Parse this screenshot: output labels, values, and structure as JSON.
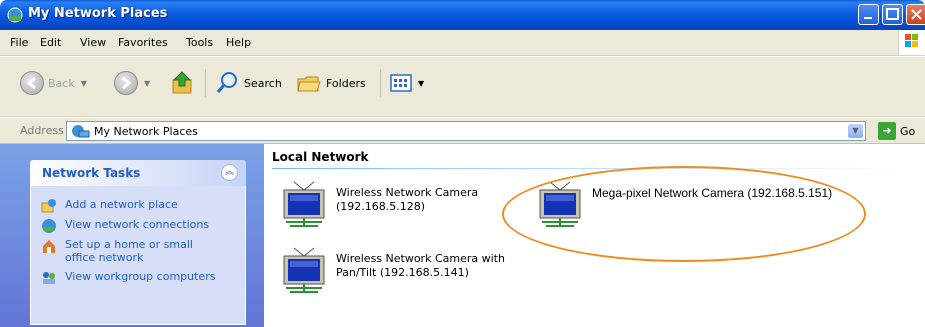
{
  "window": {
    "title": "My Network Places",
    "title_icon": "network-places-icon"
  },
  "menu": {
    "items": [
      "File",
      "Edit",
      "View",
      "Favorites",
      "Tools",
      "Help"
    ]
  },
  "toolbar": {
    "back_label": "Back",
    "search_label": "Search",
    "folders_label": "Folders"
  },
  "address": {
    "label": "Address",
    "value": "My Network Places",
    "go_label": "Go"
  },
  "tasks": {
    "title": "Network Tasks",
    "items": [
      {
        "label": "Add a network place",
        "icon": "add-network-place-icon"
      },
      {
        "label": "View network connections",
        "icon": "network-connections-icon"
      },
      {
        "label": "Set up a home or small office network",
        "icon": "home-network-icon"
      },
      {
        "label": "View workgroup computers",
        "icon": "workgroup-icon"
      }
    ]
  },
  "content": {
    "group_title": "Local Network",
    "items": [
      {
        "line1": "Wireless Network Camera",
        "line2": "(192.168.5.128)"
      },
      {
        "line1": "Mega-pixel Network Camera (192.168.5.151)",
        "line2": ""
      },
      {
        "line1": "Wireless Network Camera with",
        "line2": "Pan/Tilt (192.168.5.141)"
      }
    ]
  },
  "colors": {
    "titlebar": "#0550d6",
    "task_link": "#215dc6",
    "highlight": "#ef8c1e"
  }
}
